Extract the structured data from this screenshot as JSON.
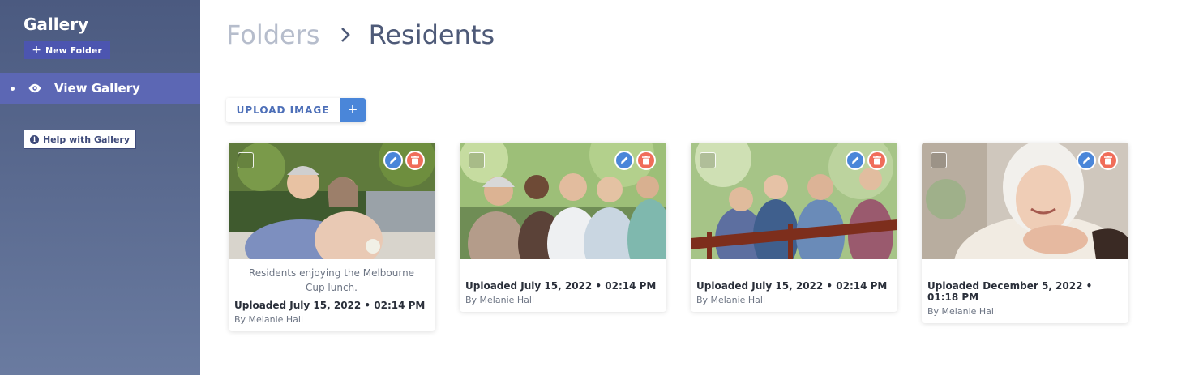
{
  "sidebar": {
    "title": "Gallery",
    "new_folder_label": "New Folder",
    "nav": [
      {
        "label": "View Gallery",
        "icon": "eye-icon",
        "active": true
      }
    ],
    "help_label": "Help with Gallery"
  },
  "breadcrumb": {
    "parent": "Folders",
    "current": "Residents"
  },
  "upload": {
    "label": "UPLOAD IMAGE",
    "plus": "+"
  },
  "colors": {
    "sidebar_active": "#5c67b4",
    "accent_blue": "#4a86d9",
    "delete_red": "#f06d5a"
  },
  "images": [
    {
      "caption": "Residents enjoying the Melbourne Cup lunch.",
      "uploaded": "Uploaded July 15, 2022 • 02:14 PM",
      "by": "By Melanie Hall"
    },
    {
      "caption": "",
      "uploaded": "Uploaded July 15, 2022 • 02:14 PM",
      "by": "By Melanie Hall"
    },
    {
      "caption": "",
      "uploaded": "Uploaded July 15, 2022 • 02:14 PM",
      "by": "By Melanie Hall"
    },
    {
      "caption": "",
      "uploaded": "Uploaded December 5, 2022 • 01:18 PM",
      "by": "By Melanie Hall"
    }
  ]
}
